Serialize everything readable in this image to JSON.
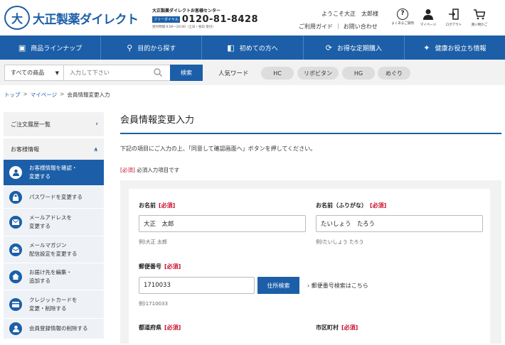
{
  "header": {
    "logo_text": "大正製薬ダイレクト",
    "logo_mark": "大",
    "callcenter_name": "大正製薬ダイレクトお客様センター",
    "free_badge": "フリーダイヤル",
    "phone": "0120-81-8428",
    "hours": "受付時間 9:00〜20:00（土日・祝日 受付）",
    "welcome": "ようこそ大正　太郎様",
    "links": [
      "ご利用ガイド",
      "お問い合わせ"
    ],
    "icons": [
      {
        "label": "よくあるご質問",
        "icon": "question-circle-icon",
        "glyph": "?"
      },
      {
        "label": "マイページ",
        "icon": "person-icon",
        "glyph": "👤"
      },
      {
        "label": "ログアウト",
        "icon": "logout-icon",
        "glyph": "⇥"
      },
      {
        "label": "買い物かご",
        "icon": "cart-icon",
        "glyph": "🛒"
      }
    ]
  },
  "nav": [
    {
      "label": "商品ラインナップ",
      "icon": "product-icon",
      "glyph": "▣"
    },
    {
      "label": "目的から探す",
      "icon": "search-icon",
      "glyph": "⚲"
    },
    {
      "label": "初めての方へ",
      "icon": "beginner-icon",
      "glyph": "◧"
    },
    {
      "label": "お得な定期購入",
      "icon": "refresh-icon",
      "glyph": "⟳"
    },
    {
      "label": "健康お役立ち情報",
      "icon": "sparkle-icon",
      "glyph": "✦"
    }
  ],
  "search": {
    "category": "すべての商品",
    "placeholder": "入力して下さい",
    "button": "検索",
    "popular_label": "人気ワード",
    "tags": [
      "HC",
      "リポビタン",
      "HG",
      "めぐり"
    ]
  },
  "breadcrumb": [
    "トップ",
    "マイページ",
    "会員情報変更入力"
  ],
  "sidebar": {
    "order_history": "ご注文履歴一覧",
    "customer_info": "お客様情報",
    "items": [
      {
        "label1": "お客様情報を確認・",
        "label2": "変更する",
        "icon": "person-icon",
        "glyph": "●"
      },
      {
        "label1": "パスワードを変更する",
        "label2": "",
        "icon": "lock-icon",
        "glyph": "🔒"
      },
      {
        "label1": "メールアドレスを",
        "label2": "変更する",
        "icon": "mail-icon",
        "glyph": "✉"
      },
      {
        "label1": "メールマガジン",
        "label2": "配信設定を変更する",
        "icon": "newsletter-icon",
        "glyph": "✉"
      },
      {
        "label1": "お届け先を編集・",
        "label2": "追加する",
        "icon": "home-icon",
        "glyph": "⌂"
      },
      {
        "label1": "クレジットカードを",
        "label2": "変更・削除する",
        "icon": "credit-card-icon",
        "glyph": "▭"
      },
      {
        "label1": "会員登録情報の削除する",
        "label2": "",
        "icon": "user-delete-icon",
        "glyph": "●"
      }
    ]
  },
  "main": {
    "title": "会員情報変更入力",
    "instruction": "下記の項目にご入力の上、「同意して確認画面へ」ボタンを押してください。",
    "required_tag": "[必須]",
    "required_note": "必須入力項目です",
    "form": {
      "name_label": "お名前",
      "name_value": "大正　太郎",
      "name_example": "例)大正 太郎",
      "kana_label": "お名前（ふりがな）",
      "kana_value": "たいしょう　たろう",
      "kana_example": "例)たいしょう たろう",
      "zip_label": "郵便番号",
      "zip_value": "1710033",
      "zip_example": "例)1710033",
      "address_button": "住所検索",
      "zip_link": "郵便番号検索はこちら",
      "pref_label": "都道府県",
      "city_label": "市区町村"
    }
  }
}
